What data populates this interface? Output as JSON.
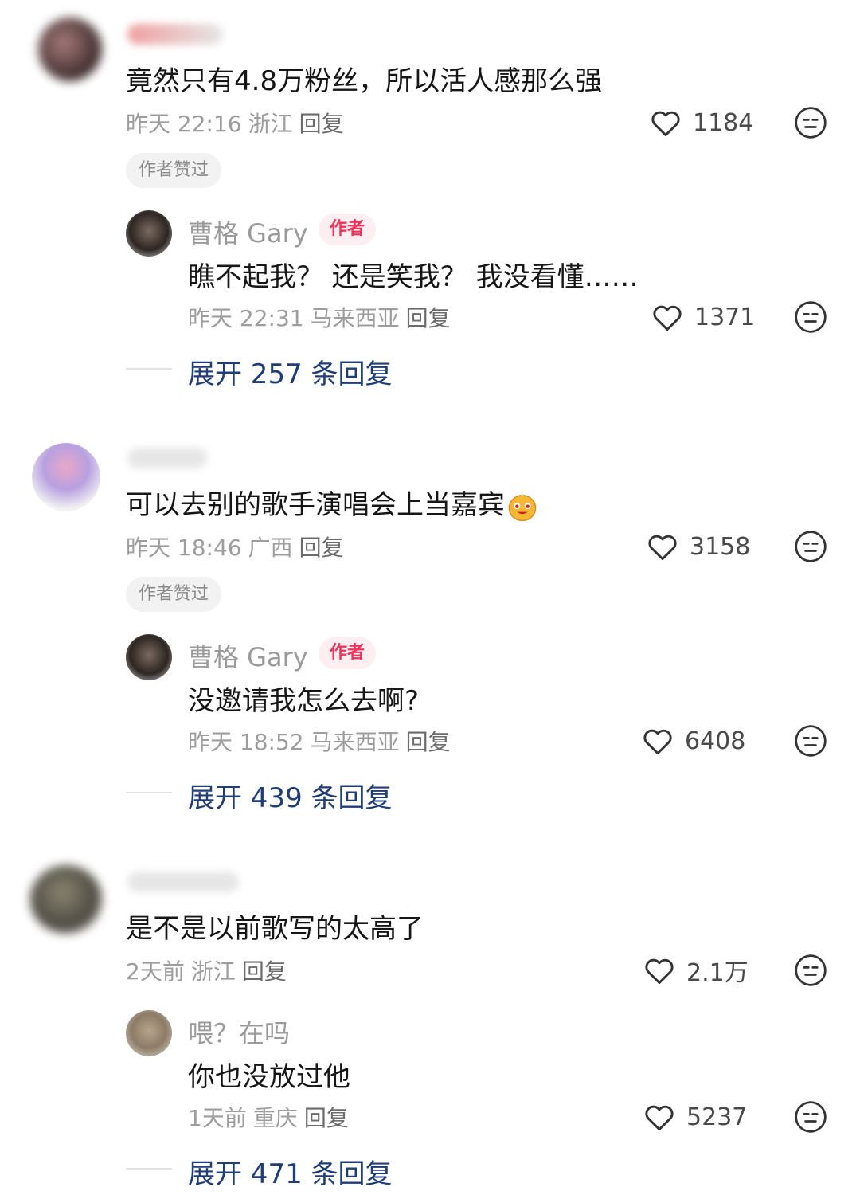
{
  "comments": [
    {
      "text": "竟然只有4.8万粉丝，所以活人感那么强",
      "time": "昨天 22:16",
      "location": "浙江",
      "reply_label": "回复",
      "likes": "1184",
      "badge": "作者赞过",
      "replies": [
        {
          "name": "曹格 Gary",
          "author_tag": "作者",
          "text": "瞧不起我？ 还是笑我？ 我没看懂……",
          "time": "昨天 22:31",
          "location": "马来西亚",
          "reply_label": "回复",
          "likes": "1371"
        }
      ],
      "expand": "展开 257 条回复"
    },
    {
      "text": "可以去别的歌手演唱会上当嘉宾",
      "time": "昨天 18:46",
      "location": "广西",
      "reply_label": "回复",
      "likes": "3158",
      "badge": "作者赞过",
      "replies": [
        {
          "name": "曹格 Gary",
          "author_tag": "作者",
          "text": "没邀请我怎么去啊?",
          "time": "昨天 18:52",
          "location": "马来西亚",
          "reply_label": "回复",
          "likes": "6408"
        }
      ],
      "expand": "展开 439 条回复"
    },
    {
      "text": "是不是以前歌写的太高了",
      "time": "2天前",
      "location": "浙江",
      "reply_label": "回复",
      "likes": "2.1万",
      "replies": [
        {
          "name": "喂？在吗",
          "text": "你也没放过他",
          "time": "1天前",
          "location": "重庆",
          "reply_label": "回复",
          "likes": "5237"
        }
      ],
      "expand": "展开 471 条回复"
    }
  ],
  "icons": {
    "like": "heart-outline-icon",
    "reaction": "neutral-face-icon",
    "inline_emoji": "smiling-emoji"
  },
  "colors": {
    "author_tag": "#f0335b",
    "expand_link": "#1f3d78",
    "meta": "#9d9d9d"
  }
}
